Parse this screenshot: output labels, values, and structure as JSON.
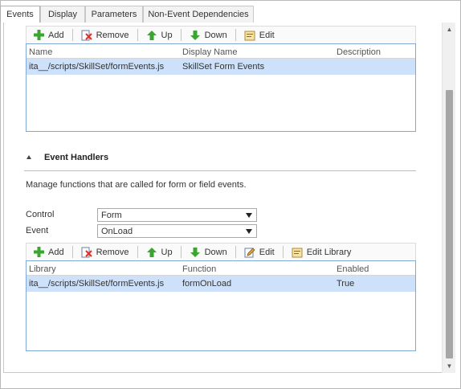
{
  "tabs": [
    {
      "label": "Events"
    },
    {
      "label": "Display"
    },
    {
      "label": "Parameters"
    },
    {
      "label": "Non-Event Dependencies"
    }
  ],
  "libraries_toolbar": {
    "add": "Add",
    "remove": "Remove",
    "up": "Up",
    "down": "Down",
    "edit": "Edit"
  },
  "libraries_grid": {
    "columns": [
      "Name",
      "Display Name",
      "Description"
    ],
    "rows": [
      {
        "name": "ita__/scripts/SkillSet/formEvents.js",
        "display_name": "SkillSet Form Events",
        "description": ""
      }
    ]
  },
  "event_handlers": {
    "title": "Event Handlers",
    "description": "Manage functions that are called for form or field events.",
    "control_label": "Control",
    "control_value": "Form",
    "event_label": "Event",
    "event_value": "OnLoad"
  },
  "handlers_toolbar": {
    "add": "Add",
    "remove": "Remove",
    "up": "Up",
    "down": "Down",
    "edit": "Edit",
    "edit_library": "Edit Library"
  },
  "handlers_grid": {
    "columns": [
      "Library",
      "Function",
      "Enabled"
    ],
    "rows": [
      {
        "library": "ita__/scripts/SkillSet/formEvents.js",
        "function": "formOnLoad",
        "enabled": "True"
      }
    ]
  },
  "colors": {
    "selected_row": "#cde1fa",
    "grid_border": "#7fa7d8",
    "add_icon": "#3aa52f",
    "remove_icon": "#d8322a",
    "arrow_icon": "#3aa52f"
  }
}
